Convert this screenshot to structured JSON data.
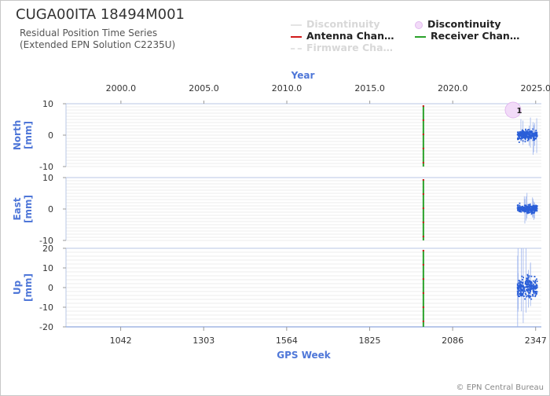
{
  "header": {
    "title": "CUGA00ITA 18494M001",
    "subtitle_line1": "Residual Position Time Series",
    "subtitle_line2": "(Extended EPN Solution C2235U)"
  },
  "legend": [
    {
      "label": "Discontinuity",
      "style": "line",
      "color": "#e4e4e4",
      "muted": true
    },
    {
      "label": "Discontinuity",
      "style": "circle",
      "color": "#e9c7f2",
      "muted": false
    },
    {
      "label": "Antenna Chan…",
      "style": "line",
      "color": "#d11a1a",
      "muted": false
    },
    {
      "label": "Receiver Chan…",
      "style": "line",
      "color": "#2aa12a",
      "muted": false
    },
    {
      "label": "Firmware Cha…",
      "style": "dash",
      "color": "#e4e4e4",
      "muted": true
    }
  ],
  "credit": "© EPN Central Bureau",
  "colors": {
    "data": "#2b5fd8",
    "axis_label": "#4f77d8",
    "grid": "#e6e6e6",
    "antenna": "#d11a1a",
    "receiver": "#2aa12a"
  },
  "chart_data": [
    {
      "type": "scatter",
      "panel": "North",
      "ylabel": "North [mm]",
      "ylim": [
        -10,
        10
      ],
      "yticks": [
        -10,
        0,
        10
      ],
      "x_top_label": "Year",
      "x_top_ticks": [
        "2000.0",
        "2005.0",
        "2010.0",
        "2015.0",
        "2020.0",
        "2025.0"
      ],
      "x_bottom_label": "GPS Week",
      "x_bottom_ticks": [
        "1042",
        "1303",
        "1564",
        "1825",
        "2086",
        "2347"
      ],
      "xlim": [
        870,
        2365
      ],
      "data_range_weeks": [
        2290,
        2352
      ],
      "data_level_mm": 0,
      "data_spread_mm": 1.5,
      "antenna_change_week": 1994,
      "receiver_change_week": 1994,
      "discontinuity": {
        "week": 2276,
        "value_mm": 8,
        "label": "1"
      }
    },
    {
      "type": "scatter",
      "panel": "East",
      "ylabel": "East [mm]",
      "ylim": [
        -10,
        10
      ],
      "yticks": [
        -10,
        0,
        10
      ],
      "xlim": [
        870,
        2365
      ],
      "data_range_weeks": [
        2290,
        2352
      ],
      "data_level_mm": 0,
      "data_spread_mm": 1.2,
      "antenna_change_week": 1994,
      "receiver_change_week": 1994
    },
    {
      "type": "scatter",
      "panel": "Up",
      "ylabel": "Up [mm]",
      "ylim": [
        -20,
        20
      ],
      "yticks": [
        -20,
        -10,
        0,
        10,
        20
      ],
      "xlim": [
        870,
        2365
      ],
      "data_range_weeks": [
        2290,
        2352
      ],
      "data_level_mm": 0,
      "data_spread_mm": 5,
      "antenna_change_week": 1994,
      "receiver_change_week": 1994
    }
  ]
}
